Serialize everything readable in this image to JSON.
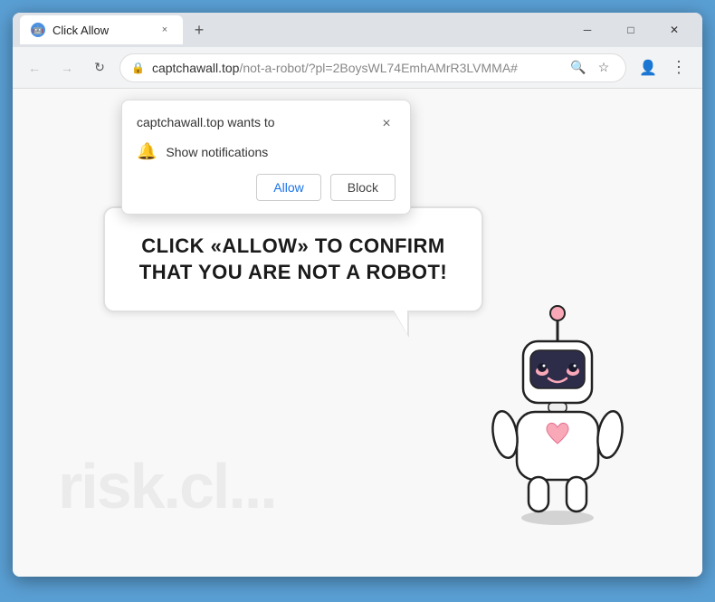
{
  "browser": {
    "tab": {
      "favicon_alt": "robot-favicon",
      "title": "Click Allow",
      "close_label": "×"
    },
    "new_tab_btn": "+",
    "window_controls": {
      "minimize": "─",
      "maximize": "□",
      "close": "✕"
    },
    "address_bar": {
      "url_domain": "captchawall.top",
      "url_path": "/not-a-robot/?pl=2BoysWL74EmhAMrR3LVMMA#",
      "lock_icon": "🔒"
    },
    "toolbar": {
      "search_icon": "🔍",
      "star_icon": "☆",
      "account_icon": "👤",
      "menu_icon": "⋮"
    }
  },
  "notification_popup": {
    "title": "captchawall.top wants to",
    "close_label": "×",
    "permission_icon": "🔔",
    "permission_text": "Show notifications",
    "allow_label": "Allow",
    "block_label": "Block"
  },
  "speech_bubble": {
    "text": "CLICK «ALLOW» TO CONFIRM THAT YOU ARE NOT A ROBOT!"
  },
  "watermark": {
    "text": "risk.cl..."
  }
}
